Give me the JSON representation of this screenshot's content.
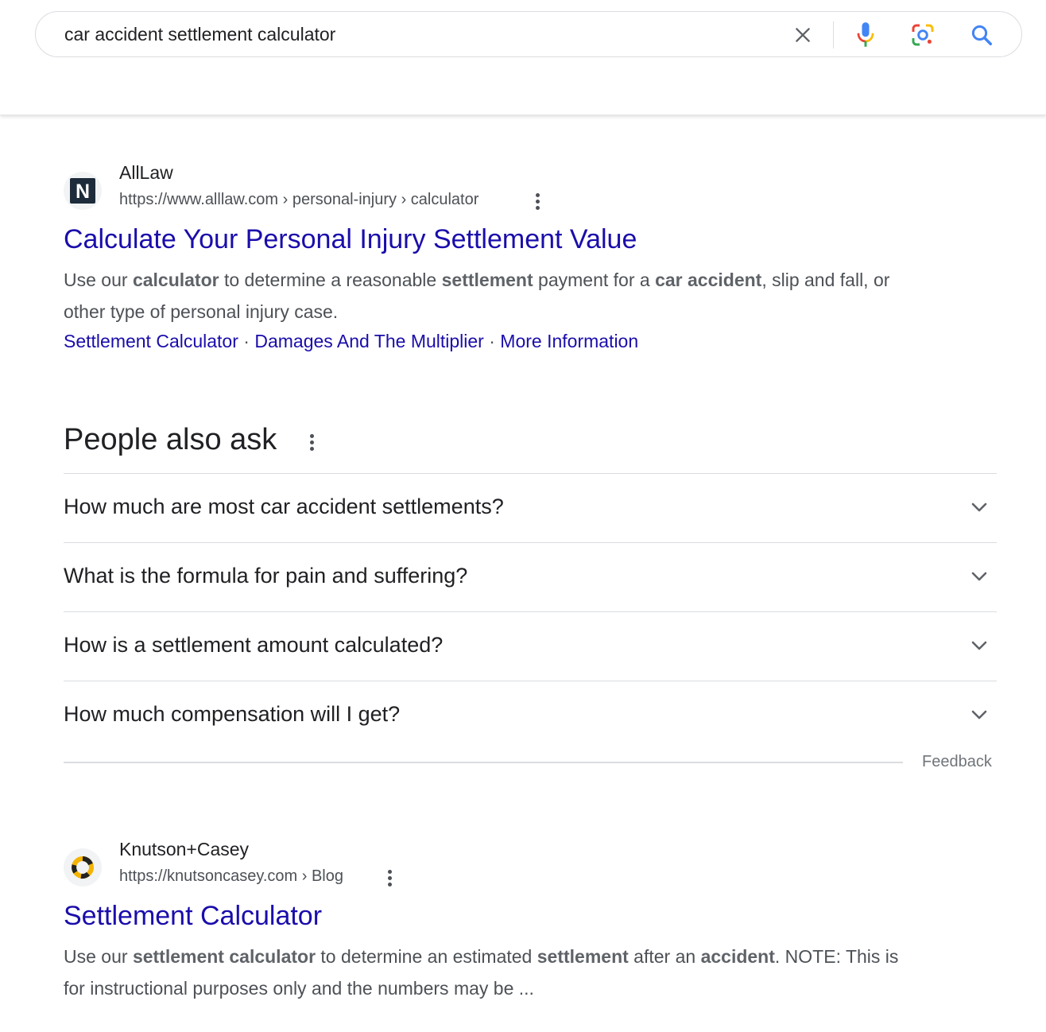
{
  "search": {
    "query": "car accident settlement calculator"
  },
  "results": [
    {
      "site_name": "AllLaw",
      "url": "https://www.alllaw.com › personal-injury › calculator",
      "favicon_letter": "N",
      "title": "Calculate Your Personal Injury Settlement Value",
      "snippet_parts": [
        {
          "t": "Use our ",
          "b": false
        },
        {
          "t": "calculator",
          "b": true
        },
        {
          "t": " to determine a reasonable ",
          "b": false
        },
        {
          "t": "settlement",
          "b": true
        },
        {
          "t": " payment for a ",
          "b": false
        },
        {
          "t": "car accident",
          "b": true
        },
        {
          "t": ", slip and fall, or other type of personal injury case.",
          "b": false
        }
      ],
      "sitelinks": [
        "Settlement Calculator",
        "Damages And The Multiplier",
        "More Information"
      ],
      "sitelink_separator": " · "
    },
    {
      "site_name": "Knutson+Casey",
      "url": "https://knutsoncasey.com › Blog",
      "title": "Settlement Calculator",
      "snippet_parts": [
        {
          "t": "Use our ",
          "b": false
        },
        {
          "t": "settlement calculator",
          "b": true
        },
        {
          "t": " to determine an estimated ",
          "b": false
        },
        {
          "t": "settlement",
          "b": true
        },
        {
          "t": " after an ",
          "b": false
        },
        {
          "t": "accident",
          "b": true
        },
        {
          "t": ". NOTE: This is for instructional purposes only and the numbers may be ...",
          "b": false
        }
      ]
    }
  ],
  "people_also_ask": {
    "title": "People also ask",
    "questions": [
      "How much are most car accident settlements?",
      "What is the formula for pain and suffering?",
      "How is a settlement amount calculated?",
      "How much compensation will I get?"
    ],
    "feedback_label": "Feedback"
  },
  "icons": {
    "clear": "close-icon",
    "voice": "mic-icon",
    "lens": "camera-lens-icon",
    "search": "search-icon",
    "more": "more-vert-icon",
    "expand": "chevron-down-icon"
  },
  "colors": {
    "link": "#1a0dab",
    "text": "#202124",
    "secondary": "#4d5156",
    "google_blue": "#4285f4",
    "google_red": "#ea4335",
    "google_yellow": "#fbbc04",
    "google_green": "#34a853"
  }
}
